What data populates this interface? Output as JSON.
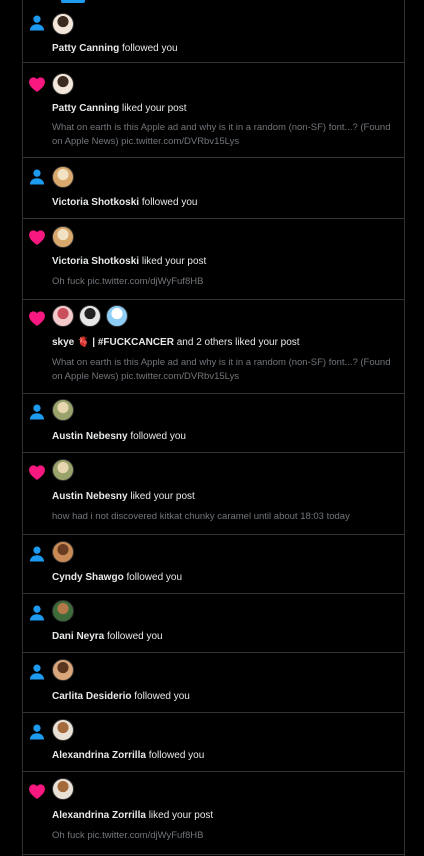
{
  "colors": {
    "like": "#f91880",
    "follow": "#1d9bf0",
    "muted_text": "#71767b",
    "border": "#2f3336"
  },
  "notifications": [
    {
      "type": "follow",
      "icon": "person-icon",
      "avatars": [
        {
          "name": "avatar-patty-canning",
          "colors": [
            "#f3e7dc",
            "#3b2a20"
          ]
        }
      ],
      "user": "Patty Canning",
      "action": "followed you",
      "preview": ""
    },
    {
      "type": "like",
      "icon": "heart-icon",
      "avatars": [
        {
          "name": "avatar-patty-canning",
          "colors": [
            "#f3e7dc",
            "#3b2a20"
          ]
        }
      ],
      "user": "Patty Canning",
      "action": "liked your post",
      "preview": "What on earth is this Apple ad and why is it in a random (non-SF) font...? (Found on Apple News) pic.twitter.com/DVRbv15Lys"
    },
    {
      "type": "follow",
      "icon": "person-icon",
      "avatars": [
        {
          "name": "avatar-victoria-shotkoski",
          "colors": [
            "#d9a86c",
            "#f1e2c4"
          ]
        }
      ],
      "user": "Victoria Shotkoski",
      "action": "followed you",
      "preview": ""
    },
    {
      "type": "like",
      "icon": "heart-icon",
      "avatars": [
        {
          "name": "avatar-victoria-shotkoski",
          "colors": [
            "#d9a86c",
            "#f1e2c4"
          ]
        }
      ],
      "user": "Victoria Shotkoski",
      "action": "liked your post",
      "preview": "Oh fuck pic.twitter.com/djWyFuf8HB"
    },
    {
      "type": "like",
      "icon": "heart-icon",
      "avatars": [
        {
          "name": "avatar-skye",
          "colors": [
            "#f4c9c9",
            "#c94d5a"
          ]
        },
        {
          "name": "avatar-n-logo",
          "colors": [
            "#e6e6e6",
            "#222222"
          ]
        },
        {
          "name": "avatar-cartoon",
          "colors": [
            "#8ecdf5",
            "#ffffff"
          ]
        }
      ],
      "user": "skye 🫀 | #FUCKCANCER",
      "action": "and 2 others liked your post",
      "preview": "What on earth is this Apple ad and why is it in a random (non-SF) font...? (Found on Apple News) pic.twitter.com/DVRbv15Lys"
    },
    {
      "type": "follow",
      "icon": "person-icon",
      "avatars": [
        {
          "name": "avatar-austin-nebesny",
          "colors": [
            "#9aa36c",
            "#e7d6b0"
          ]
        }
      ],
      "user": "Austin Nebesny",
      "action": "followed you",
      "preview": ""
    },
    {
      "type": "like",
      "icon": "heart-icon",
      "avatars": [
        {
          "name": "avatar-austin-nebesny",
          "colors": [
            "#9aa36c",
            "#e7d6b0"
          ]
        }
      ],
      "user": "Austin Nebesny",
      "action": "liked your post",
      "preview": "how had i not discovered kitkat chunky caramel until about 18:03 today"
    },
    {
      "type": "follow",
      "icon": "person-icon",
      "avatars": [
        {
          "name": "avatar-cyndy-shawgo",
          "colors": [
            "#c98a55",
            "#6a3d22"
          ]
        }
      ],
      "user": "Cyndy Shawgo",
      "action": "followed you",
      "preview": ""
    },
    {
      "type": "follow",
      "icon": "person-icon",
      "avatars": [
        {
          "name": "avatar-dani-neyra",
          "colors": [
            "#3e6b3a",
            "#b4784a"
          ]
        }
      ],
      "user": "Dani Neyra",
      "action": "followed you",
      "preview": ""
    },
    {
      "type": "follow",
      "icon": "person-icon",
      "avatars": [
        {
          "name": "avatar-carlita-desiderio",
          "colors": [
            "#d9a57a",
            "#5a3520"
          ]
        }
      ],
      "user": "Carlita Desiderio",
      "action": "followed you",
      "preview": ""
    },
    {
      "type": "follow",
      "icon": "person-icon",
      "avatars": [
        {
          "name": "avatar-alexandrina-zorrilla",
          "colors": [
            "#e9e1d6",
            "#a56a3c"
          ]
        }
      ],
      "user": "Alexandrina Zorrilla",
      "action": "followed you",
      "preview": ""
    },
    {
      "type": "like",
      "icon": "heart-icon",
      "avatars": [
        {
          "name": "avatar-alexandrina-zorrilla",
          "colors": [
            "#e9e1d6",
            "#a56a3c"
          ]
        }
      ],
      "user": "Alexandrina Zorrilla",
      "action": "liked your post",
      "preview": "Oh fuck pic.twitter.com/djWyFuf8HB"
    }
  ]
}
